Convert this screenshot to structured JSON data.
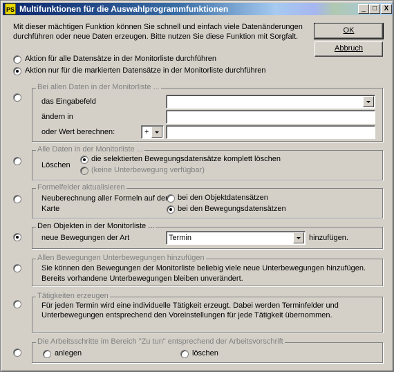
{
  "window": {
    "title": "Multifunktionen für die Auswahlprogrammfunktionen",
    "minimize_glyph": "_",
    "maximize_glyph": "□",
    "close_glyph": "X"
  },
  "intro": {
    "line1": "Mit dieser mächtigen Funktion können Sie schnell und einfach viele Datenänderungen",
    "line2": "durchführen oder neue Daten erzeugen. Bitte nutzen Sie diese Funktion mit Sorgfalt."
  },
  "buttons": {
    "ok": "OK",
    "abbruch": "Abbruch"
  },
  "scope": {
    "all": "Aktion für alle Datensätze in der Monitorliste durchführen",
    "marked": "Aktion nur für die markierten Datensätze in der Monitorliste durchführen"
  },
  "group1": {
    "title": "Bei allen Daten in der Monitorliste ...",
    "field_label": "das Eingabefeld",
    "field_value": "",
    "change_label": "ändern in",
    "change_value": "",
    "compute_label": "oder Wert berechnen:",
    "operator": "+",
    "compute_value": ""
  },
  "group2": {
    "title": "Alle Daten in der Monitorliste ...",
    "action_label": "Löschen",
    "option1": "die selektierten Bewegungsdatensätze komplett löschen",
    "option2": "(keine Unterbewegung verfügbar)"
  },
  "group3": {
    "title": "Formelfelder aktualisieren",
    "label_line1": "Neuberechnung aller Formeln auf der",
    "label_line2": "Karte",
    "option1": "bei den Objektdatensätzen",
    "option2": "bei den Bewegungsdatensätzen"
  },
  "group4": {
    "title": "Den Objekten in der Monitorliste ...",
    "label": "neue Bewegungen der Art",
    "selected": "Termin",
    "suffix": "hinzufügen."
  },
  "group5": {
    "title": "Allen Bewegungen Unterbewegungen hinzufügen",
    "line1": "Sie können den Bewegungen der Monitorliste beliebig viele neue Unterbewegungen hinzufügen.",
    "line2": "Bereits vorhandene Unterbewegungen bleiben unverändert."
  },
  "group6": {
    "title": "Tätigkeiten erzeugen",
    "line1": "Für jeden Termin wird eine individuelle Tätigkeit erzeugt. Dabei werden Terminfelder und",
    "line2": "Unterbewegungen entsprechend den Voreinstellungen für jede Tätigkeit übernommen."
  },
  "group7": {
    "title": "Die Arbeitsschritte im Bereich \"Zu tun\" entsprechend der Arbeitsvorschrift",
    "option1": "anlegen",
    "option2": "löschen"
  }
}
